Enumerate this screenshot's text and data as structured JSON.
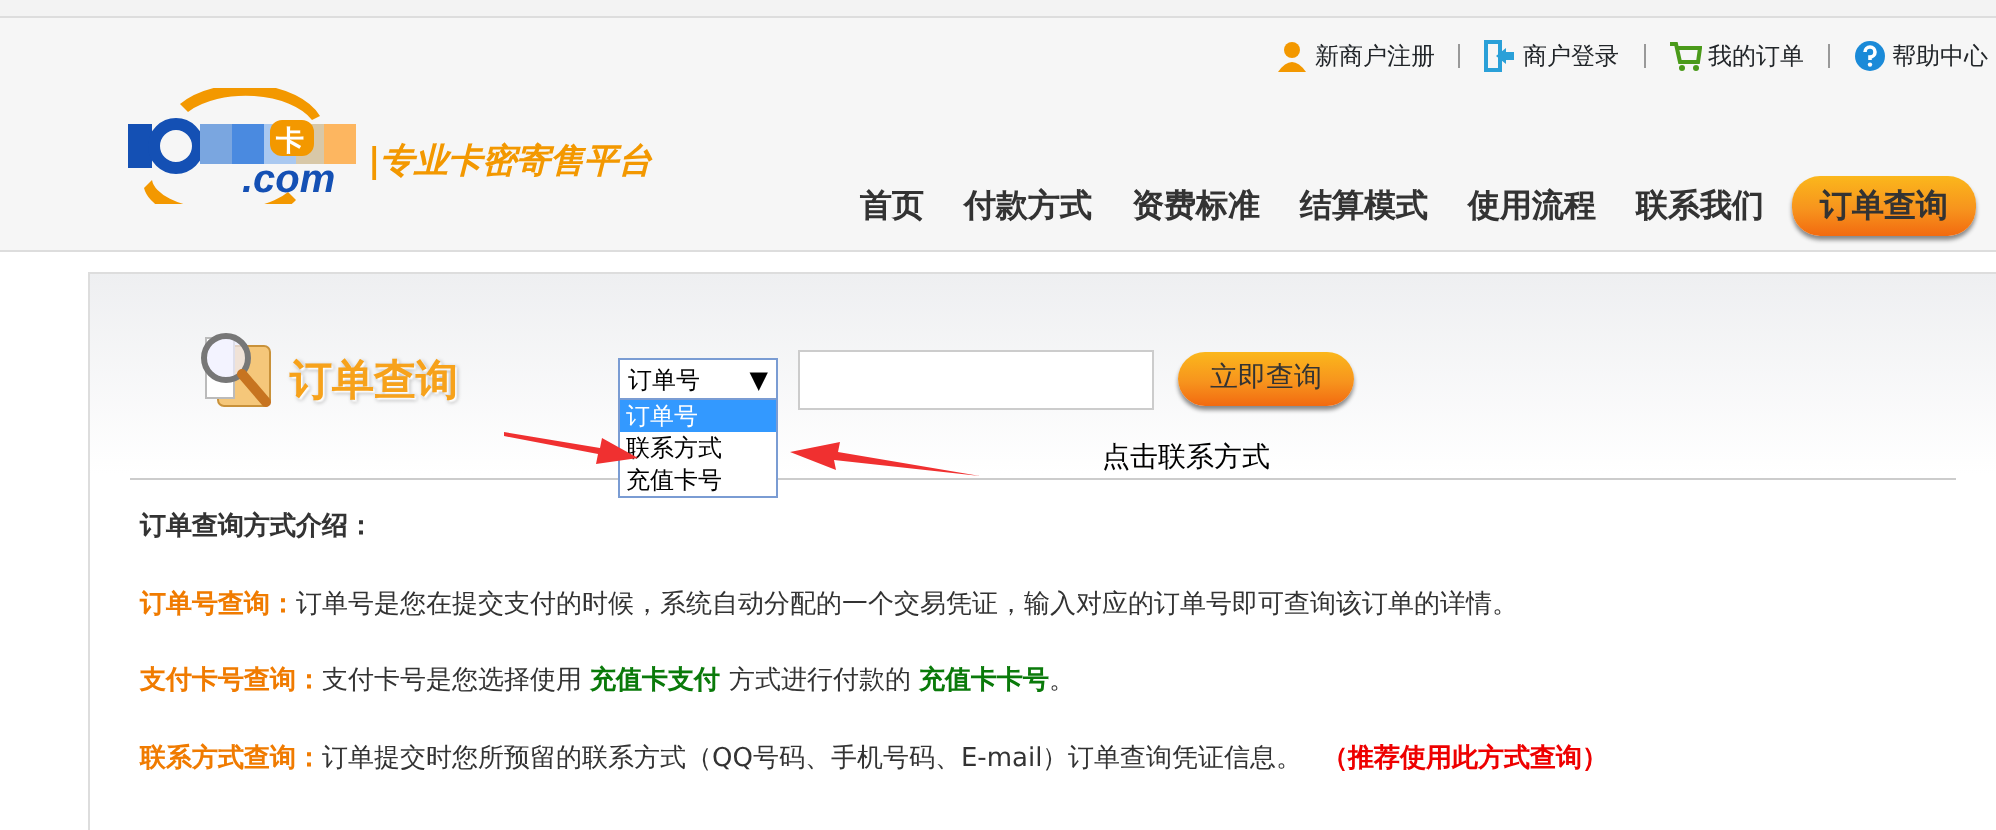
{
  "top_links": [
    {
      "kind": "user",
      "label": "新商户注册"
    },
    {
      "kind": "login",
      "label": "商户登录"
    },
    {
      "kind": "cart",
      "label": "我的订单"
    },
    {
      "kind": "help",
      "label": "帮助中心"
    }
  ],
  "logo": {
    "suffix": ".com",
    "badge": "卡",
    "slogan": "|专业卡密寄售平台"
  },
  "nav": [
    {
      "label": "首页",
      "selected": false
    },
    {
      "label": "付款方式",
      "selected": false
    },
    {
      "label": "资费标准",
      "selected": false
    },
    {
      "label": "结算模式",
      "selected": false
    },
    {
      "label": "使用流程",
      "selected": false
    },
    {
      "label": "联系我们",
      "selected": false
    },
    {
      "label": "订单查询",
      "selected": true
    }
  ],
  "query": {
    "title": "订单查询",
    "select_value": "订单号",
    "caret": "▼",
    "options": [
      {
        "label": "订单号",
        "selected": true
      },
      {
        "label": "联系方式",
        "selected": false
      },
      {
        "label": "充值卡号",
        "selected": false
      }
    ],
    "submit": "立即查询",
    "note": "点击联系方式"
  },
  "intro": {
    "heading": "订单查询方式介绍：",
    "items": [
      {
        "label": "订单号查询：",
        "text": "订单号是您在提交支付的时候，系统自动分配的一个交易凭证，输入对应的订单号即可查询该订单的详情。"
      },
      {
        "label": "支付卡号查询：",
        "text": "支付卡号是您选择使用 **充值卡支付** 方式进行付款的 **充值卡卡号**。"
      },
      {
        "label": "联系方式查询：",
        "text": "订单提交时您所预留的联系方式（QQ号码、手机号码、E-mail）订单查询凭证信息。",
        "highlight": "（推荐使用此方式查询）"
      }
    ]
  }
}
